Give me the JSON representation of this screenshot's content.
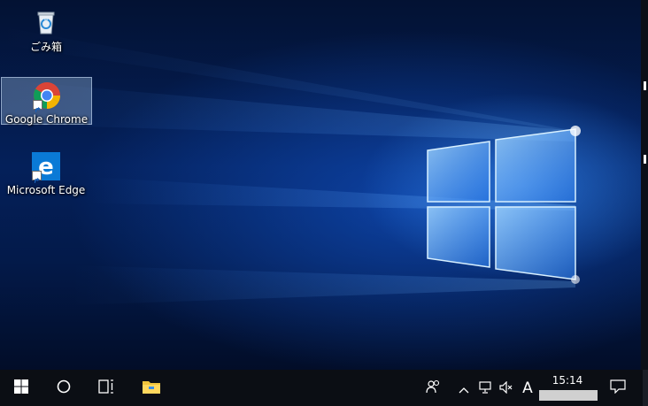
{
  "desktop": {
    "icons": [
      {
        "label": "ごみ箱",
        "icon": "recycle-bin-icon"
      },
      {
        "label": "Google Chrome",
        "icon": "chrome-icon",
        "selected": true
      },
      {
        "label": "Microsoft Edge",
        "icon": "edge-icon"
      }
    ]
  },
  "taskbar": {
    "start_icon": "windows-start-icon",
    "search_icon": "cortana-circle-icon",
    "taskview_icon": "task-view-icon",
    "pinned": [
      {
        "icon": "file-explorer-icon"
      }
    ],
    "tray": {
      "people_icon": "people-icon",
      "show_hidden_icon": "chevron-up-icon",
      "network_icon": "network-icon",
      "volume_icon": "volume-muted-icon",
      "ime_label": "A",
      "time": "15:14",
      "notification_icon": "action-center-icon"
    }
  },
  "colors": {
    "taskbar": "#0b0e14",
    "selection": "#aac8eb",
    "wallpaper_accent": "#1e78ff"
  }
}
